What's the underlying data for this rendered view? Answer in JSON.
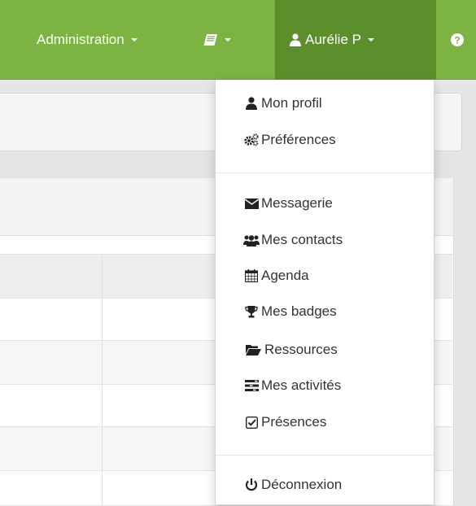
{
  "navbar": {
    "admin_label": "Administration",
    "user_label": "Aurélie P",
    "accent": "#7cb342",
    "active_bg": "#5c8f2c",
    "icons": [
      "book-icon",
      "user-icon",
      "question-circle-icon"
    ]
  },
  "user_menu": {
    "items": [
      {
        "label": "Mon profil",
        "icon": "user-icon"
      },
      {
        "label": "Préférences",
        "icon": "cogs-icon"
      },
      {
        "label": "Messagerie",
        "icon": "envelope-icon"
      },
      {
        "label": "Mes contacts",
        "icon": "users-icon"
      },
      {
        "label": "Agenda",
        "icon": "calendar-icon"
      },
      {
        "label": "Mes badges",
        "icon": "trophy-icon"
      },
      {
        "label": "Ressources",
        "icon": "folder-open-icon"
      },
      {
        "label": "Mes activités",
        "icon": "tasks-icon"
      },
      {
        "label": "Présences",
        "icon": "check-square-icon"
      },
      {
        "label": "Déconnexion",
        "icon": "power-icon"
      }
    ]
  }
}
